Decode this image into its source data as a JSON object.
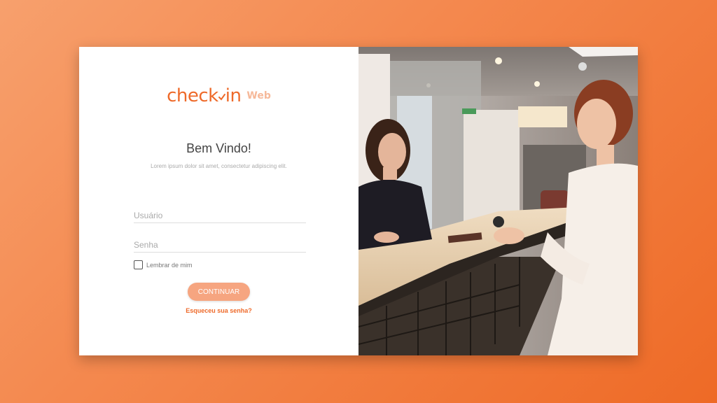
{
  "brand": {
    "logo_main_prefix": "check",
    "logo_main_suffix": "in",
    "logo_sub": "Web"
  },
  "login": {
    "title": "Bem Vindo!",
    "subtitle": "Lorem ipsum dolor sit amet, consectetur adipiscing elit.",
    "username_placeholder": "Usuário",
    "password_placeholder": "Senha",
    "remember_label": "Lembrar de mim",
    "submit_label": "CONTINUAR",
    "forgot_label": "Esqueceu sua senha?"
  },
  "colors": {
    "brand_orange": "#ee6a2a",
    "button": "#f6a580",
    "background_gradient": [
      "#f7a06d",
      "#ee6a26"
    ]
  }
}
